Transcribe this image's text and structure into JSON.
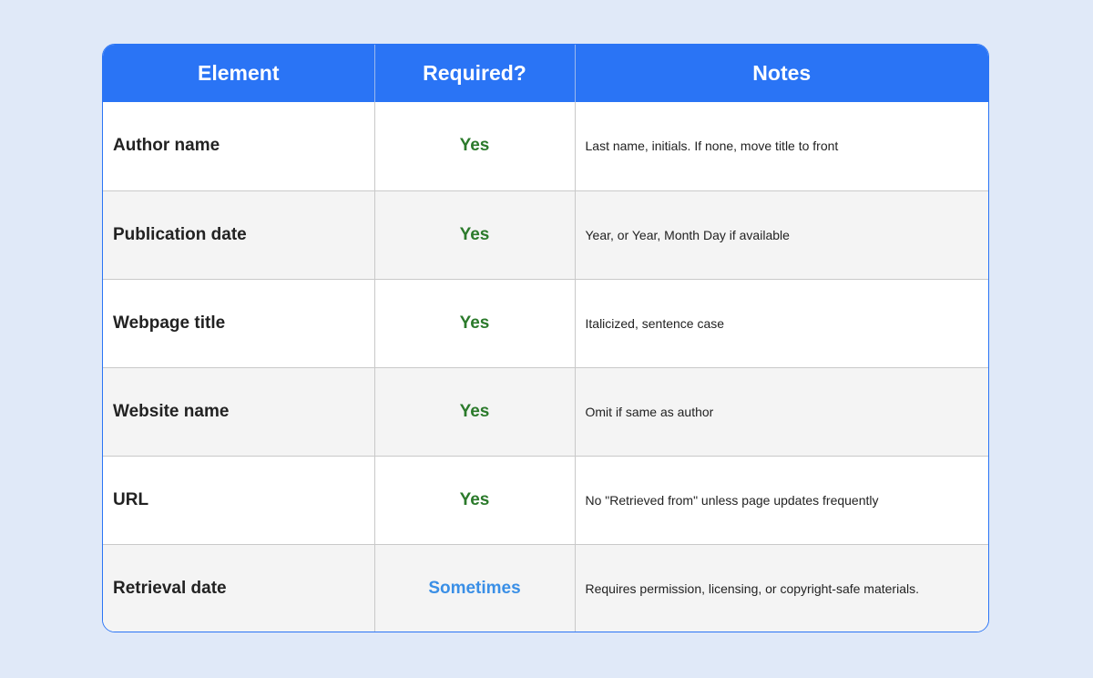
{
  "table": {
    "headers": [
      "Element",
      "Required?",
      "Notes"
    ],
    "rows": [
      {
        "element": "Author name",
        "required": "Yes",
        "notes": "Last name, initials. If none, move title to front"
      },
      {
        "element": "Publication date",
        "required": "Yes",
        "notes": "Year, or Year, Month Day if available"
      },
      {
        "element": "Webpage title",
        "required": "Yes",
        "notes": "Italicized, sentence case"
      },
      {
        "element": "Website name",
        "required": "Yes",
        "notes": "Omit if same as author"
      },
      {
        "element": "URL",
        "required": "Yes",
        "notes": "No \"Retrieved from\" unless page updates frequently"
      },
      {
        "element": "Retrieval date",
        "required": "Sometimes",
        "notes": "Requires permission, licensing, or copyright-safe materials."
      }
    ]
  },
  "colors": {
    "background": "#e0e9f8",
    "header": "#2a74f5",
    "yes": "#2b7a2b",
    "sometimes": "#3a8fe6",
    "alt_row": "#f4f4f4"
  }
}
